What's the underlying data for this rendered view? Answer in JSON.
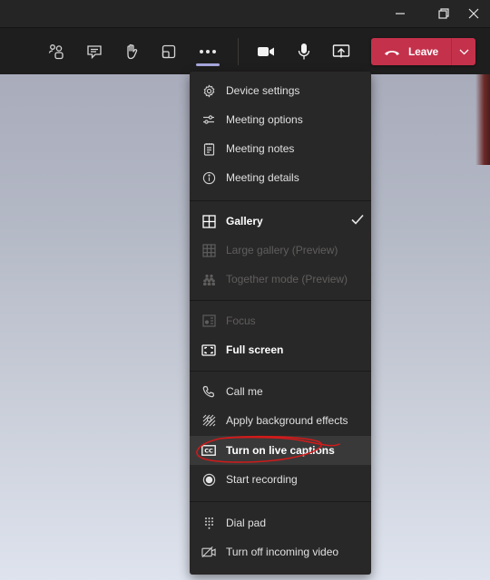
{
  "window": {
    "controls": [
      {
        "name": "minimize",
        "icon": "minimize-icon"
      },
      {
        "name": "restore",
        "icon": "restore-icon"
      },
      {
        "name": "close",
        "icon": "close-icon"
      }
    ]
  },
  "toolbar": {
    "buttons": [
      {
        "name": "participants",
        "icon": "people-icon"
      },
      {
        "name": "chat",
        "icon": "chat-icon"
      },
      {
        "name": "raise-hand",
        "icon": "hand-icon"
      },
      {
        "name": "rooms",
        "icon": "breakout-rooms-icon"
      },
      {
        "name": "more-actions",
        "icon": "more-icon",
        "active": true
      },
      {
        "name": "camera",
        "icon": "camera-icon"
      },
      {
        "name": "microphone",
        "icon": "mic-icon"
      },
      {
        "name": "share",
        "icon": "share-screen-icon"
      }
    ],
    "leave": {
      "label": "Leave",
      "icon": "phone-hangup-icon",
      "dropdown_icon": "chevron-down-icon",
      "color": "#c4314b"
    },
    "active_indicator_color": "#a6a7dc"
  },
  "menu": {
    "groups": [
      [
        {
          "label": "Device settings",
          "icon": "gear-icon",
          "state": "normal"
        },
        {
          "label": "Meeting options",
          "icon": "sliders-icon",
          "state": "normal"
        },
        {
          "label": "Meeting notes",
          "icon": "notes-icon",
          "state": "normal"
        },
        {
          "label": "Meeting details",
          "icon": "info-icon",
          "state": "normal"
        }
      ],
      [
        {
          "label": "Gallery",
          "icon": "gallery-icon",
          "state": "selected",
          "checked": true
        },
        {
          "label": "Large gallery (Preview)",
          "icon": "large-gallery-icon",
          "state": "disabled"
        },
        {
          "label": "Together mode (Preview)",
          "icon": "together-mode-icon",
          "state": "disabled"
        }
      ],
      [
        {
          "label": "Focus",
          "icon": "focus-icon",
          "state": "disabled"
        },
        {
          "label": "Full screen",
          "icon": "fullscreen-icon",
          "state": "bold"
        }
      ],
      [
        {
          "label": "Call me",
          "icon": "phone-icon",
          "state": "normal"
        },
        {
          "label": "Apply background effects",
          "icon": "background-effects-icon",
          "state": "normal"
        },
        {
          "label": "Turn on live captions",
          "icon": "cc-icon",
          "state": "highlighted",
          "annotated": true
        },
        {
          "label": "Start recording",
          "icon": "record-icon",
          "state": "normal"
        }
      ],
      [
        {
          "label": "Dial pad",
          "icon": "dialpad-icon",
          "state": "normal"
        },
        {
          "label": "Turn off incoming video",
          "icon": "video-off-icon",
          "state": "normal"
        }
      ]
    ]
  },
  "annotation": {
    "color": "#d11a1a",
    "target": "Turn on live captions"
  }
}
